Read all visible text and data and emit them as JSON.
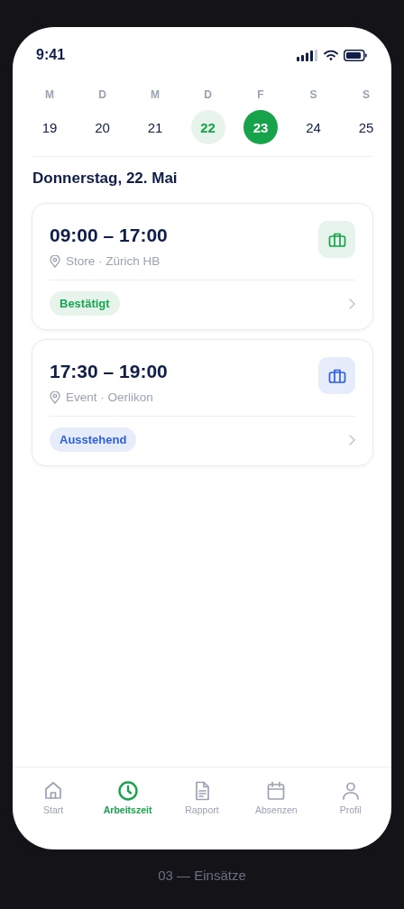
{
  "status_bar": {
    "time": "9:41"
  },
  "week": [
    {
      "weekday": "M",
      "day": "19",
      "selected": false,
      "today": false
    },
    {
      "weekday": "D",
      "day": "20",
      "selected": false,
      "today": false
    },
    {
      "weekday": "M",
      "day": "21",
      "selected": false,
      "today": false
    },
    {
      "weekday": "D",
      "day": "22",
      "selected": false,
      "today": true
    },
    {
      "weekday": "F",
      "day": "23",
      "selected": true,
      "today": false
    },
    {
      "weekday": "S",
      "day": "24",
      "selected": false,
      "today": false
    },
    {
      "weekday": "S",
      "day": "25",
      "selected": false,
      "today": false
    }
  ],
  "date_heading": "Donnerstag, 22. Mai",
  "shifts": [
    {
      "time": "09:00 – 17:00",
      "location": "Store · Zürich HB",
      "status": "Bestätigt",
      "kind": "confirmed"
    },
    {
      "time": "17:30 – 19:00",
      "location": "Event · Oerlikon",
      "status": "Ausstehend",
      "kind": "pending"
    }
  ],
  "nav": [
    {
      "label": "Start",
      "kind": "home",
      "selected": false
    },
    {
      "label": "Arbeitszeit",
      "kind": "clock",
      "selected": true
    },
    {
      "label": "Rapport",
      "kind": "document",
      "selected": false
    },
    {
      "label": "Absenzen",
      "kind": "calendar",
      "selected": false
    },
    {
      "label": "Profil",
      "kind": "person",
      "selected": false
    }
  ],
  "caption": "03 — Einsätze"
}
